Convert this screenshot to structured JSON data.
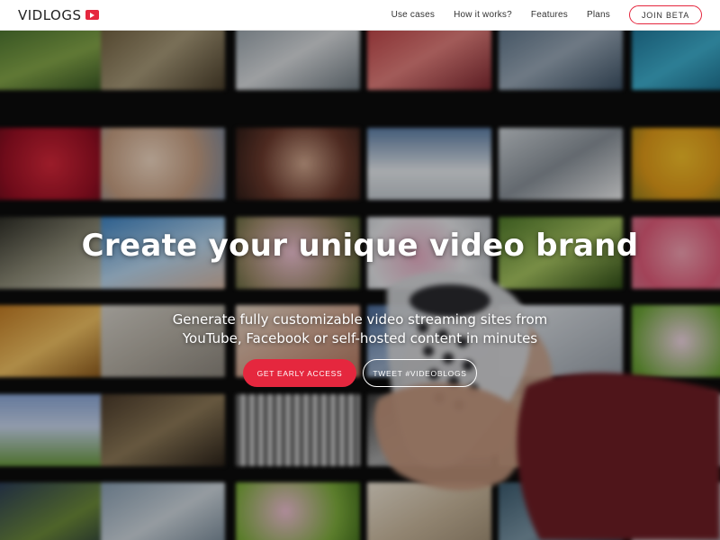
{
  "brand": {
    "name": "VIDLOGS",
    "logo_icon": "play-icon",
    "accent_color": "#e5273e"
  },
  "nav": {
    "links": [
      "Use cases",
      "How it works?",
      "Features",
      "Plans"
    ],
    "join_label": "JOIN BETA"
  },
  "hero": {
    "title": "Create your unique video brand",
    "subtitle_lines": [
      "Generate fully customizable video streaming sites from",
      "YouTube, Facebook or self-hosted content in minutes"
    ],
    "primary_cta": "GET EARLY ACCESS",
    "secondary_cta": "TWEET #VIDEOBLOGS"
  }
}
